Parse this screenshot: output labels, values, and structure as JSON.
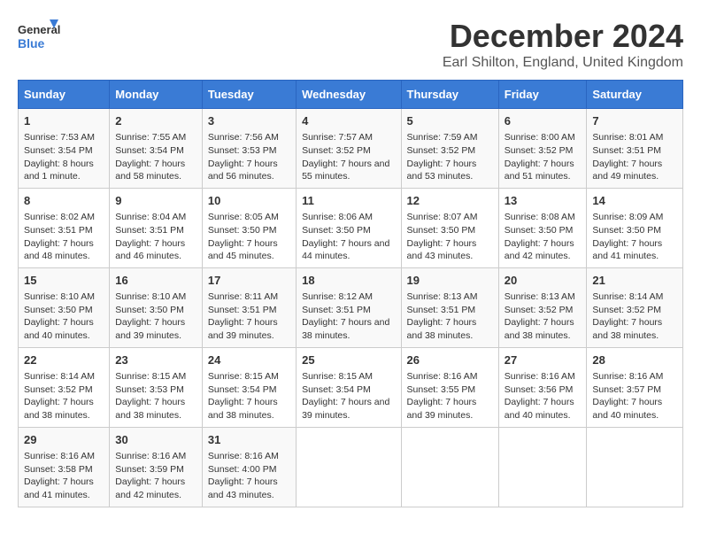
{
  "header": {
    "logo_general": "General",
    "logo_blue": "Blue",
    "title": "December 2024",
    "subtitle": "Earl Shilton, England, United Kingdom"
  },
  "columns": [
    "Sunday",
    "Monday",
    "Tuesday",
    "Wednesday",
    "Thursday",
    "Friday",
    "Saturday"
  ],
  "weeks": [
    [
      {
        "day": "1",
        "sunrise": "Sunrise: 7:53 AM",
        "sunset": "Sunset: 3:54 PM",
        "daylight": "Daylight: 8 hours and 1 minute."
      },
      {
        "day": "2",
        "sunrise": "Sunrise: 7:55 AM",
        "sunset": "Sunset: 3:54 PM",
        "daylight": "Daylight: 7 hours and 58 minutes."
      },
      {
        "day": "3",
        "sunrise": "Sunrise: 7:56 AM",
        "sunset": "Sunset: 3:53 PM",
        "daylight": "Daylight: 7 hours and 56 minutes."
      },
      {
        "day": "4",
        "sunrise": "Sunrise: 7:57 AM",
        "sunset": "Sunset: 3:52 PM",
        "daylight": "Daylight: 7 hours and 55 minutes."
      },
      {
        "day": "5",
        "sunrise": "Sunrise: 7:59 AM",
        "sunset": "Sunset: 3:52 PM",
        "daylight": "Daylight: 7 hours and 53 minutes."
      },
      {
        "day": "6",
        "sunrise": "Sunrise: 8:00 AM",
        "sunset": "Sunset: 3:52 PM",
        "daylight": "Daylight: 7 hours and 51 minutes."
      },
      {
        "day": "7",
        "sunrise": "Sunrise: 8:01 AM",
        "sunset": "Sunset: 3:51 PM",
        "daylight": "Daylight: 7 hours and 49 minutes."
      }
    ],
    [
      {
        "day": "8",
        "sunrise": "Sunrise: 8:02 AM",
        "sunset": "Sunset: 3:51 PM",
        "daylight": "Daylight: 7 hours and 48 minutes."
      },
      {
        "day": "9",
        "sunrise": "Sunrise: 8:04 AM",
        "sunset": "Sunset: 3:51 PM",
        "daylight": "Daylight: 7 hours and 46 minutes."
      },
      {
        "day": "10",
        "sunrise": "Sunrise: 8:05 AM",
        "sunset": "Sunset: 3:50 PM",
        "daylight": "Daylight: 7 hours and 45 minutes."
      },
      {
        "day": "11",
        "sunrise": "Sunrise: 8:06 AM",
        "sunset": "Sunset: 3:50 PM",
        "daylight": "Daylight: 7 hours and 44 minutes."
      },
      {
        "day": "12",
        "sunrise": "Sunrise: 8:07 AM",
        "sunset": "Sunset: 3:50 PM",
        "daylight": "Daylight: 7 hours and 43 minutes."
      },
      {
        "day": "13",
        "sunrise": "Sunrise: 8:08 AM",
        "sunset": "Sunset: 3:50 PM",
        "daylight": "Daylight: 7 hours and 42 minutes."
      },
      {
        "day": "14",
        "sunrise": "Sunrise: 8:09 AM",
        "sunset": "Sunset: 3:50 PM",
        "daylight": "Daylight: 7 hours and 41 minutes."
      }
    ],
    [
      {
        "day": "15",
        "sunrise": "Sunrise: 8:10 AM",
        "sunset": "Sunset: 3:50 PM",
        "daylight": "Daylight: 7 hours and 40 minutes."
      },
      {
        "day": "16",
        "sunrise": "Sunrise: 8:10 AM",
        "sunset": "Sunset: 3:50 PM",
        "daylight": "Daylight: 7 hours and 39 minutes."
      },
      {
        "day": "17",
        "sunrise": "Sunrise: 8:11 AM",
        "sunset": "Sunset: 3:51 PM",
        "daylight": "Daylight: 7 hours and 39 minutes."
      },
      {
        "day": "18",
        "sunrise": "Sunrise: 8:12 AM",
        "sunset": "Sunset: 3:51 PM",
        "daylight": "Daylight: 7 hours and 38 minutes."
      },
      {
        "day": "19",
        "sunrise": "Sunrise: 8:13 AM",
        "sunset": "Sunset: 3:51 PM",
        "daylight": "Daylight: 7 hours and 38 minutes."
      },
      {
        "day": "20",
        "sunrise": "Sunrise: 8:13 AM",
        "sunset": "Sunset: 3:52 PM",
        "daylight": "Daylight: 7 hours and 38 minutes."
      },
      {
        "day": "21",
        "sunrise": "Sunrise: 8:14 AM",
        "sunset": "Sunset: 3:52 PM",
        "daylight": "Daylight: 7 hours and 38 minutes."
      }
    ],
    [
      {
        "day": "22",
        "sunrise": "Sunrise: 8:14 AM",
        "sunset": "Sunset: 3:52 PM",
        "daylight": "Daylight: 7 hours and 38 minutes."
      },
      {
        "day": "23",
        "sunrise": "Sunrise: 8:15 AM",
        "sunset": "Sunset: 3:53 PM",
        "daylight": "Daylight: 7 hours and 38 minutes."
      },
      {
        "day": "24",
        "sunrise": "Sunrise: 8:15 AM",
        "sunset": "Sunset: 3:54 PM",
        "daylight": "Daylight: 7 hours and 38 minutes."
      },
      {
        "day": "25",
        "sunrise": "Sunrise: 8:15 AM",
        "sunset": "Sunset: 3:54 PM",
        "daylight": "Daylight: 7 hours and 39 minutes."
      },
      {
        "day": "26",
        "sunrise": "Sunrise: 8:16 AM",
        "sunset": "Sunset: 3:55 PM",
        "daylight": "Daylight: 7 hours and 39 minutes."
      },
      {
        "day": "27",
        "sunrise": "Sunrise: 8:16 AM",
        "sunset": "Sunset: 3:56 PM",
        "daylight": "Daylight: 7 hours and 40 minutes."
      },
      {
        "day": "28",
        "sunrise": "Sunrise: 8:16 AM",
        "sunset": "Sunset: 3:57 PM",
        "daylight": "Daylight: 7 hours and 40 minutes."
      }
    ],
    [
      {
        "day": "29",
        "sunrise": "Sunrise: 8:16 AM",
        "sunset": "Sunset: 3:58 PM",
        "daylight": "Daylight: 7 hours and 41 minutes."
      },
      {
        "day": "30",
        "sunrise": "Sunrise: 8:16 AM",
        "sunset": "Sunset: 3:59 PM",
        "daylight": "Daylight: 7 hours and 42 minutes."
      },
      {
        "day": "31",
        "sunrise": "Sunrise: 8:16 AM",
        "sunset": "Sunset: 4:00 PM",
        "daylight": "Daylight: 7 hours and 43 minutes."
      },
      null,
      null,
      null,
      null
    ]
  ]
}
